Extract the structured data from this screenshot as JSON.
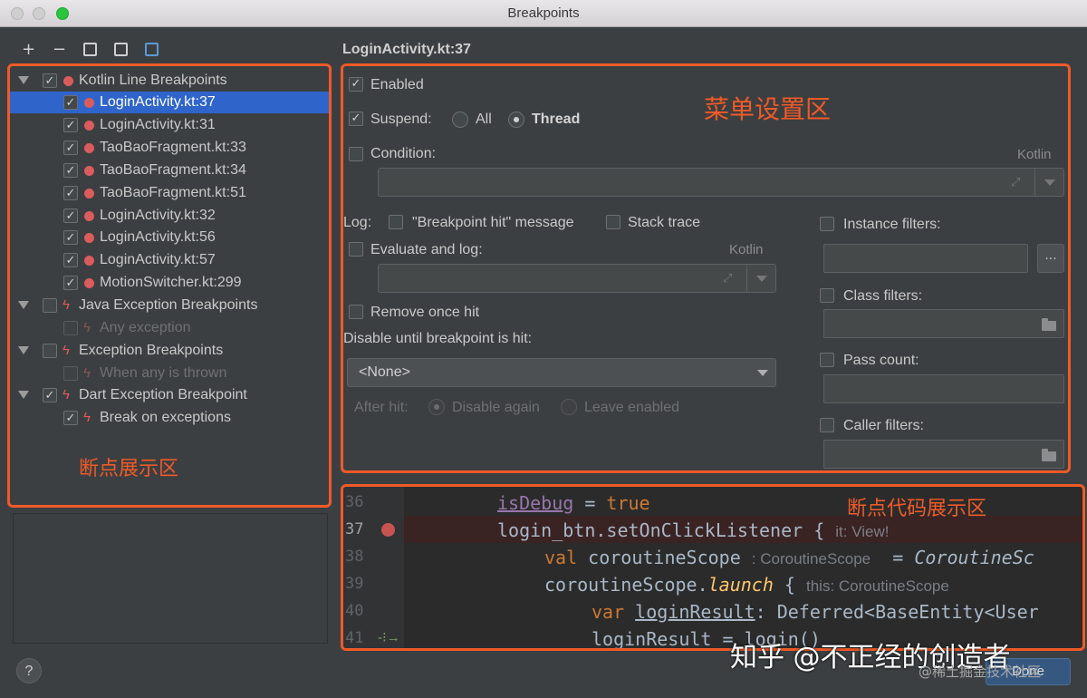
{
  "window": {
    "title": "Breakpoints"
  },
  "toolbar": {
    "add": "+",
    "remove": "−"
  },
  "tree": {
    "groups": [
      {
        "label": "Kotlin Line Breakpoints",
        "checked": true,
        "icon": "red-dot-icon"
      },
      {
        "label": "Java Exception Breakpoints",
        "checked": false,
        "icon": "lightning-icon"
      },
      {
        "label": "Exception Breakpoints",
        "checked": false,
        "icon": "lightning-icon"
      },
      {
        "label": "Dart Exception Breakpoint",
        "checked": true,
        "icon": "lightning-icon"
      }
    ],
    "kotlin_items": [
      "LoginActivity.kt:37",
      "LoginActivity.kt:31",
      "TaoBaoFragment.kt:33",
      "TaoBaoFragment.kt:34",
      "TaoBaoFragment.kt:51",
      "LoginActivity.kt:32",
      "LoginActivity.kt:56",
      "LoginActivity.kt:57",
      "MotionSwitcher.kt:299"
    ],
    "java_child": "Any exception",
    "exception_child": "When any is thrown",
    "dart_child": "Break on exceptions"
  },
  "annotations": {
    "tree": "断点展示区",
    "settings": "菜单设置区",
    "code": "断点代码展示区"
  },
  "settings": {
    "header": "LoginActivity.kt:37",
    "enabled": "Enabled",
    "suspend": "Suspend:",
    "all": "All",
    "thread": "Thread",
    "condition": "Condition:",
    "kotlin": "Kotlin",
    "log": "Log:",
    "bp_hit_message": "\"Breakpoint hit\" message",
    "stack_trace": "Stack trace",
    "evaluate_and_log": "Evaluate and log:",
    "remove_once_hit": "Remove once hit",
    "disable_until": "Disable until breakpoint is hit:",
    "disable_select": "<None>",
    "after_hit": "After hit:",
    "disable_again": "Disable again",
    "leave_enabled": "Leave enabled",
    "instance_filters": "Instance filters:",
    "class_filters": "Class filters:",
    "pass_count": "Pass count:",
    "caller_filters": "Caller filters:",
    "dots": "..."
  },
  "code": {
    "line_numbers": [
      "36",
      "37",
      "38",
      "39",
      "40",
      "41"
    ],
    "current_line": "37",
    "lines": [
      {
        "a": "isDebug",
        "b": " = ",
        "c": "true"
      },
      {
        "a": "login_btn.setOnClickListener { ",
        "hint": "it: View!"
      },
      {
        "kw": "val",
        "a": " coroutineScope ",
        "hint": ": CoroutineScope",
        "b": "  = ",
        "c": "CoroutineSc"
      },
      {
        "a": "coroutineScope.",
        "it": "launch",
        "b": " { ",
        "hint": "this: CoroutineScope"
      },
      {
        "kw": "var",
        "a": "loginResult",
        "b": ": Deferred<BaseEntity<User"
      },
      {
        "a": "loginResult = login()"
      }
    ]
  },
  "footer": {
    "help": "?",
    "done": "Done"
  },
  "watermark": {
    "main": "知乎 @不正经的创造者",
    "sub": "@稀土掘金技术社区"
  }
}
